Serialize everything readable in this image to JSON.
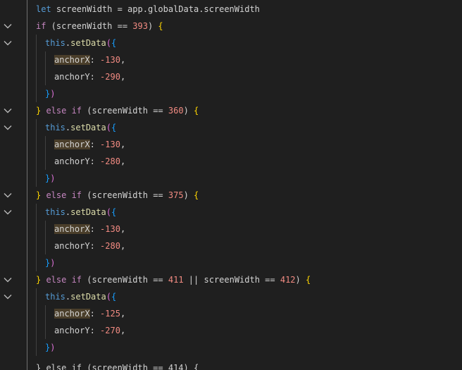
{
  "editor": {
    "lines": [
      [
        "let",
        " screenWidth = app.globalData.screenWidth"
      ],
      [
        "if",
        " (",
        "screenWidth == ",
        "393",
        ") ",
        "{"
      ],
      [
        "this",
        ".",
        "setData",
        "(",
        "{"
      ],
      [
        "anchorX",
        ": ",
        "-130",
        ","
      ],
      [
        "anchorY",
        ": ",
        "-290",
        ","
      ],
      [
        "}",
        ")"
      ],
      [
        "}",
        " else if ",
        "(",
        "screenWidth == ",
        "360",
        ") ",
        "{"
      ],
      [
        "this",
        ".",
        "setData",
        "(",
        "{"
      ],
      [
        "anchorX",
        ": ",
        "-130",
        ","
      ],
      [
        "anchorY",
        ": ",
        "-280",
        ","
      ],
      [
        "}",
        ")"
      ],
      [
        "}",
        " else if ",
        "(",
        "screenWidth == ",
        "375",
        ") ",
        "{"
      ],
      [
        "this",
        ".",
        "setData",
        "(",
        "{"
      ],
      [
        "anchorX",
        ": ",
        "-130",
        ","
      ],
      [
        "anchorY",
        ": ",
        "-280",
        ","
      ],
      [
        "}",
        ")"
      ],
      [
        "}",
        " else if ",
        "(",
        "screenWidth == ",
        "411",
        " || ",
        "screenWidth == ",
        "412",
        ") ",
        "{"
      ],
      [
        "this",
        ".",
        "setData",
        "(",
        "{"
      ],
      [
        "anchorX",
        ": ",
        "-125",
        ","
      ],
      [
        "anchorY",
        ": ",
        "-270",
        ","
      ],
      [
        "}",
        ")"
      ],
      [
        "} else if (screenWidth == 414) {"
      ]
    ]
  },
  "icons": {
    "fold": "chevron-down-icon"
  }
}
